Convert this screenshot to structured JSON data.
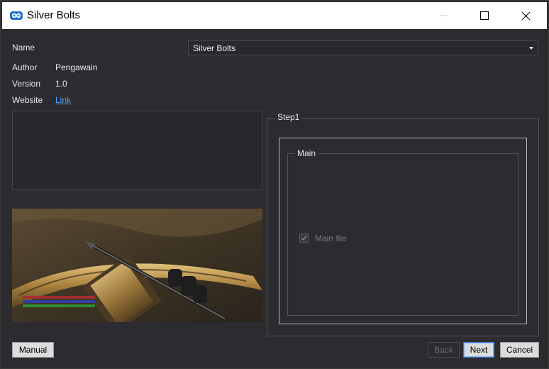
{
  "window": {
    "title": "Silver Bolts",
    "app_icon": "mod-organizer-icon",
    "controls": {
      "minimize": "minimize-icon",
      "maximize": "maximize-icon",
      "close": "close-icon"
    }
  },
  "info": {
    "name_label": "Name",
    "name_value": "Silver Bolts",
    "author_label": "Author",
    "author_value": "Pengawain",
    "version_label": "Version",
    "version_value": "1.0",
    "website_label": "Website",
    "website_link": "Link"
  },
  "step": {
    "title": "Step1",
    "group_title": "Main",
    "option_label": "Main file",
    "option_checked": true,
    "option_enabled": false
  },
  "buttons": {
    "manual": "Manual",
    "back": "Back",
    "next": "Next",
    "cancel": "Cancel"
  },
  "colors": {
    "background": "#2c2b2f",
    "link": "#4aa3ff",
    "titlebar": "#ffffff"
  }
}
